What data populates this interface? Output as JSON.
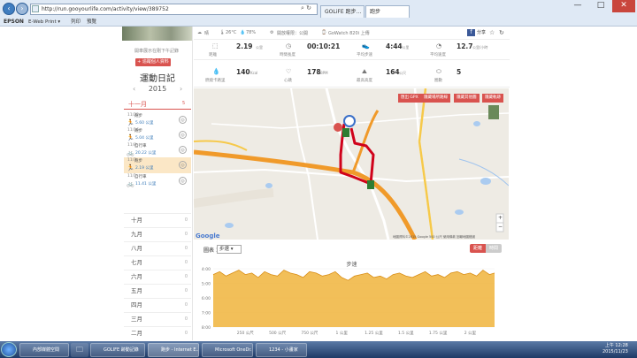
{
  "browser": {
    "url": "http://run.gooyourlife.com/activity/view/389752",
    "tabs": [
      "GOLiFE 跑步...",
      "跑步"
    ],
    "window_controls": [
      "—",
      "□",
      "✕"
    ],
    "toolbar_left": [
      "EPSON",
      "E-Web Print ▾",
      "列印",
      "預覽"
    ],
    "toolbar_right": [
      "f",
      "分享",
      "☆",
      "↻"
    ]
  },
  "sidebar": {
    "photo_caption": "開車展示在剛下午記錄",
    "join_button": "+ 追蹤個人資料",
    "title": "運動日記",
    "year": "2015",
    "year_prev": "‹",
    "year_next": "›",
    "current_month": "十一月",
    "current_month_count": "5",
    "activities": [
      {
        "date": "11/22",
        "name": "跑步",
        "icon": "runner-icon",
        "value": "5.60 公里"
      },
      {
        "date": "11/16",
        "name": "跑步",
        "icon": "runner-icon",
        "value": "5.04 公里"
      },
      {
        "date": "11/8",
        "name": "自行車",
        "icon": "bike-icon",
        "value": "20.22 公里"
      },
      {
        "date": "11/3",
        "name": "跑步",
        "icon": "runner-icon",
        "value": "2.19 公里"
      },
      {
        "date": "11/1",
        "name": "自行車",
        "icon": "bike-icon",
        "value": "11.41 公里"
      }
    ],
    "months": [
      {
        "label": "十月",
        "count": "0"
      },
      {
        "label": "九月",
        "count": "0"
      },
      {
        "label": "八月",
        "count": "0"
      },
      {
        "label": "七月",
        "count": "0"
      },
      {
        "label": "六月",
        "count": "0"
      },
      {
        "label": "五月",
        "count": "0"
      },
      {
        "label": "四月",
        "count": "0"
      },
      {
        "label": "三月",
        "count": "0"
      },
      {
        "label": "二月",
        "count": "0"
      }
    ]
  },
  "header_info": {
    "weather1": "晴",
    "temp": "26°C",
    "humidity": "78%",
    "share": "開放權限：公開",
    "device": "GoWatch 820i 上傳"
  },
  "stats": [
    {
      "label": "距離",
      "value": "2.19",
      "unit": "公里",
      "icon": "distance-icon"
    },
    {
      "label": "時間長度",
      "value": "00:10:21",
      "unit": "",
      "icon": "clock-icon"
    },
    {
      "label": "平均步速",
      "value": "4:44",
      "unit": "/公里",
      "icon": "shoe-icon"
    },
    {
      "label": "平均速度",
      "value": "12.7",
      "unit": "公里/小時",
      "icon": "speed-icon"
    },
    {
      "label": "燃燒卡路里",
      "value": "140",
      "unit": "Kcal",
      "icon": "calorie-icon"
    },
    {
      "label": "心跳",
      "value": "178",
      "unit": "BPM",
      "icon": "heart-icon"
    },
    {
      "label": "最高高度",
      "value": "164",
      "unit": "公尺",
      "icon": "mountain-icon"
    },
    {
      "label": "圈數",
      "value": "5",
      "unit": "",
      "icon": "laps-icon"
    }
  ],
  "map": {
    "buttons": [
      "匯出 GPX",
      "隱藏場所路線",
      "隱藏其他圖",
      "隱藏軌跡"
    ],
    "google": "Google",
    "terms": "地圖資料©2015 Google  500 公尺  使用條款  回報地圖錯誤",
    "zoom_in": "+",
    "zoom_out": "−"
  },
  "chart_controls": {
    "label": "圖表 1：",
    "select": "步速",
    "toggle_left": "距離",
    "toggle_right": "時間"
  },
  "chart_data": {
    "type": "area",
    "title": "步速",
    "yticks": [
      "4:00",
      "5:00",
      "6:00",
      "7:00",
      "8:00"
    ],
    "xticks": [
      "250 公尺",
      "500 公尺",
      "750 公尺",
      "1 公里",
      "1.25 公里",
      "1.5 公里",
      "1.75 公里",
      "2 公里"
    ],
    "color": "#f0b43c",
    "x_km": [
      0,
      0.05,
      0.1,
      0.15,
      0.2,
      0.25,
      0.3,
      0.35,
      0.4,
      0.45,
      0.5,
      0.55,
      0.6,
      0.65,
      0.7,
      0.75,
      0.8,
      0.85,
      0.9,
      0.95,
      1.0,
      1.05,
      1.1,
      1.15,
      1.2,
      1.25,
      1.3,
      1.35,
      1.4,
      1.45,
      1.5,
      1.55,
      1.6,
      1.65,
      1.7,
      1.75,
      1.8,
      1.85,
      1.9,
      1.95,
      2.0,
      2.05,
      2.1,
      2.15,
      2.19
    ],
    "values_min": [
      4.4,
      4.2,
      4.5,
      4.3,
      4.1,
      4.4,
      4.3,
      4.6,
      4.2,
      4.4,
      4.5,
      4.1,
      4.3,
      4.4,
      4.6,
      4.2,
      4.3,
      4.5,
      4.4,
      4.2,
      4.6,
      4.8,
      4.5,
      4.4,
      4.3,
      4.6,
      4.5,
      4.7,
      4.4,
      4.3,
      4.5,
      4.6,
      4.4,
      4.2,
      4.5,
      4.4,
      4.6,
      4.3,
      4.2,
      4.4,
      4.3,
      4.5,
      4.1,
      4.4,
      4.3
    ]
  },
  "taskbar": {
    "items": [
      "內部媒體空間",
      "GOLIFE 跡動記錄",
      "跑步 - Internet E...",
      "Microsoft OneDr...",
      "1234 - 小畫家"
    ],
    "time": "上午 12:28",
    "date": "2015/11/23"
  }
}
